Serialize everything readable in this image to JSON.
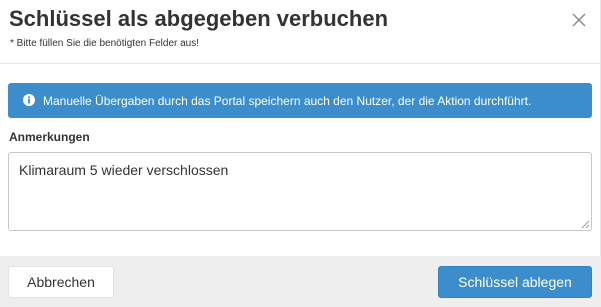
{
  "dialog": {
    "title": "Schlüssel als abgegeben verbuchen",
    "subtitle": "* Bitte füllen Sie die benötigten Felder aus!",
    "close_icon": "close-icon"
  },
  "info": {
    "icon": "info-icon",
    "text": "Manuelle Übergaben durch das Portal speichern auch den Nutzer, der die Aktion durchführt."
  },
  "remarks": {
    "label": "Anmerkungen",
    "value": "Klimaraum 5 wieder verschlossen"
  },
  "footer": {
    "cancel_label": "Abbrechen",
    "submit_label": "Schlüssel ablegen"
  },
  "colors": {
    "accent": "#3b8ecb",
    "footer_bg": "#eeeeee"
  }
}
